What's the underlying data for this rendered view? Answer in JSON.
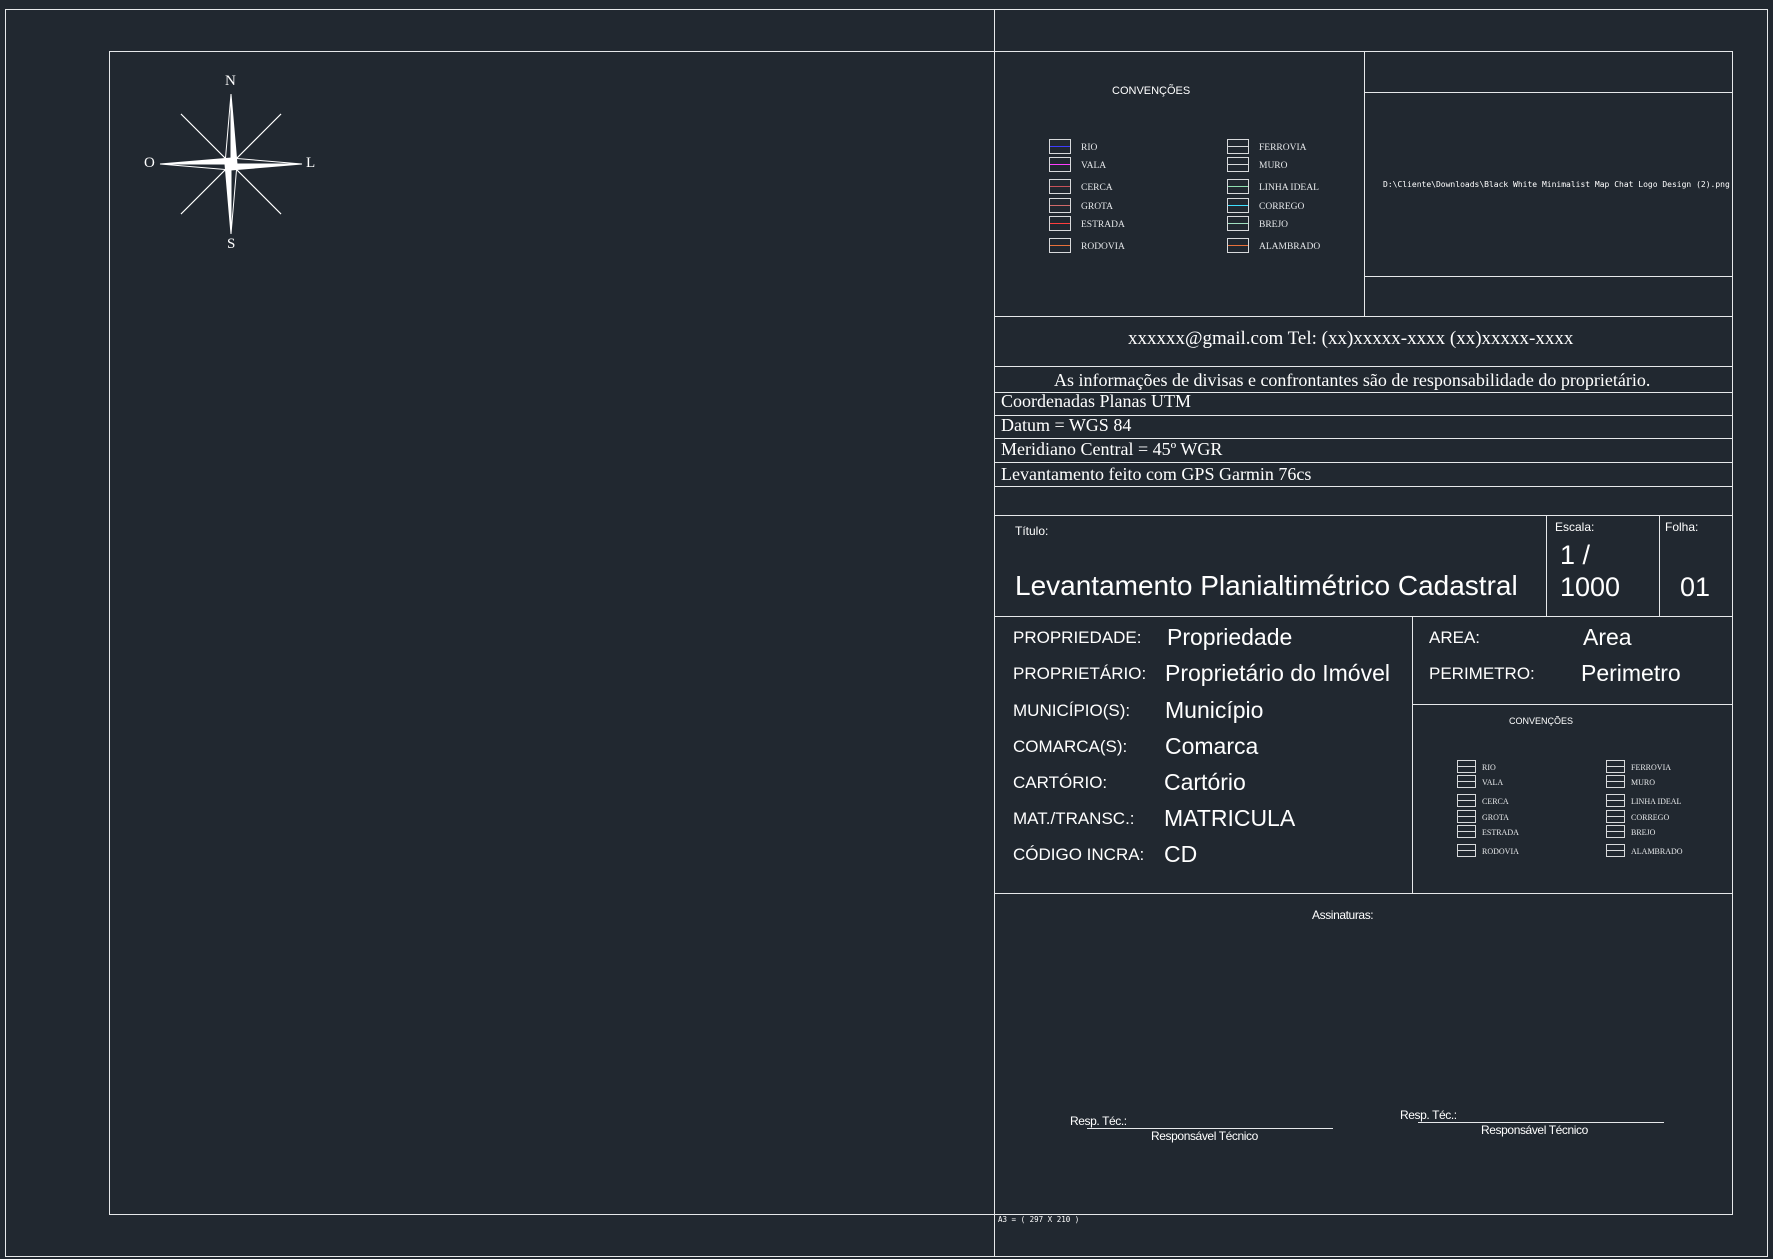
{
  "compass": {
    "n": "N",
    "s": "S",
    "w": "O",
    "e": "L"
  },
  "legend_top": {
    "title": "CONVENÇÕES",
    "left": [
      {
        "label": "RIO",
        "color": "#3d3dff"
      },
      {
        "label": "VALA",
        "color": "#ff3dff"
      },
      {
        "label": "CERCA",
        "color": "#c8525a"
      },
      {
        "label": "GROTA",
        "color": "#d06a6a"
      },
      {
        "label": "ESTRADA",
        "color": "#ff3d3d"
      },
      {
        "label": "RODOVIA",
        "color": "#e8703a"
      }
    ],
    "right": [
      {
        "label": "FERROVIA",
        "color": "#d8dadc"
      },
      {
        "label": "MURO",
        "color": "#d8dadc"
      },
      {
        "label": "LINHA IDEAL",
        "color": "#8fe0b0"
      },
      {
        "label": "CORREGO",
        "color": "#3de0ff"
      },
      {
        "label": "BREJO",
        "color": "#a0e0c0"
      },
      {
        "label": "ALAMBRADO",
        "color": "#e8703a"
      }
    ]
  },
  "logo_path": "D:\\Cliente\\Downloads\\Black White Minimalist Map Chat Logo Design (2).png",
  "contact": "xxxxxx@gmail.com Tel: (xx)xxxxx-xxxx (xx)xxxxx-xxxx",
  "notes": {
    "disclaimer": "As informações de divisas e confrontantes são de responsabilidade do proprietário.",
    "line1": "Coordenadas Planas UTM",
    "line2": "Datum = WGS 84",
    "line3": "Meridiano Central = 45º WGR",
    "line4": "Levantamento feito com GPS Garmin 76cs"
  },
  "title_block": {
    "titulo_label": "Título:",
    "titulo": "Levantamento Planialtimétrico Cadastral",
    "escala_label": "Escala:",
    "escala_a": "1 /",
    "escala_b": "1000",
    "folha_label": "Folha:",
    "folha": "01"
  },
  "fields": [
    {
      "label": "PROPRIEDADE:",
      "value": "Propriedade"
    },
    {
      "label": "PROPRIETÁRIO:",
      "value": "Proprietário do Imóvel"
    },
    {
      "label": "MUNICÍPIO(S):",
      "value": "Município"
    },
    {
      "label": "COMARCA(S):",
      "value": "Comarca"
    },
    {
      "label": "CARTÓRIO:",
      "value": "Cartório"
    },
    {
      "label": "MAT./TRANSC.:",
      "value": "MATRICULA"
    },
    {
      "label": "CÓDIGO INCRA:",
      "value": "CD"
    }
  ],
  "area": {
    "label": "AREA:",
    "value": "Area"
  },
  "perimetro": {
    "label": "PERIMETRO:",
    "value": "Perimetro"
  },
  "legend_small": {
    "title": "CONVENÇÕES",
    "left": [
      "RIO",
      "VALA",
      "CERCA",
      "GROTA",
      "ESTRADA",
      "RODOVIA"
    ],
    "right": [
      "FERROVIA",
      "MURO",
      "LINHA IDEAL",
      "CORREGO",
      "BREJO",
      "ALAMBRADO"
    ]
  },
  "signatures": {
    "title": "Assinaturas:",
    "sig1_label": "Resp. Téc.:",
    "sig1_name": "Responsável Técnico",
    "sig2_label": "Resp. Téc.:",
    "sig2_name": "Responsável Técnico"
  },
  "paper_size": "A3 = ( 297 X 210 )"
}
